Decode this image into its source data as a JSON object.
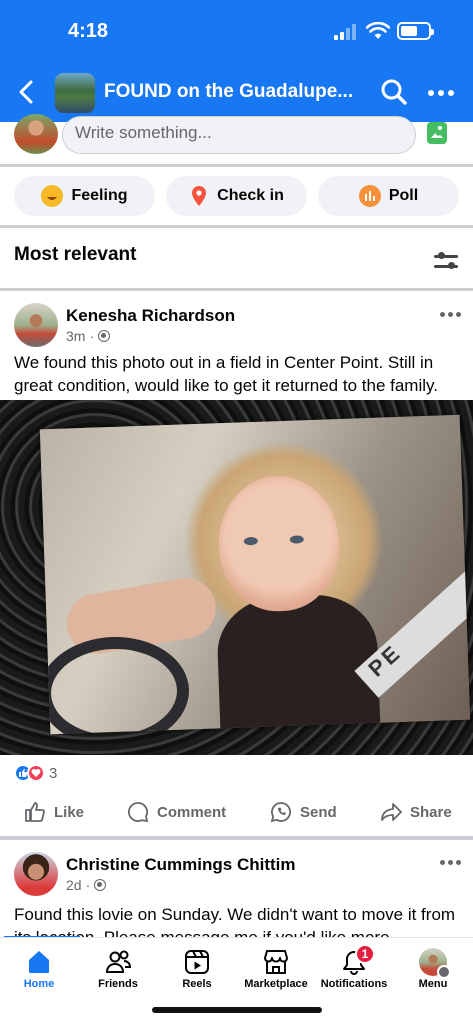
{
  "status_bar": {
    "time": "4:18"
  },
  "header": {
    "title": "FOUND on the Guadalupe...",
    "back_label": "Back"
  },
  "composer": {
    "placeholder": "Write something..."
  },
  "quick_actions": [
    {
      "label": "Feeling",
      "icon": "smiley-icon"
    },
    {
      "label": "Check in",
      "icon": "location-pin-icon"
    },
    {
      "label": "Poll",
      "icon": "poll-icon"
    }
  ],
  "feed": {
    "sort_label": "Most relevant"
  },
  "posts": [
    {
      "author": "Kenesha Richardson",
      "time": "3m",
      "text": "We found this photo out in a field in Center Point. Still in great condition, would like to get it returned to the family.",
      "reaction_count": "3",
      "image_text": "PE"
    },
    {
      "author": "Christine Cummings Chittim",
      "time": "2d",
      "text": "Found this lovie on Sunday. We didn't want to move it from its location. Please message me if you'd like more"
    }
  ],
  "post_actions": {
    "like": "Like",
    "comment": "Comment",
    "send": "Send",
    "share": "Share"
  },
  "tabs": [
    {
      "label": "Home",
      "icon": "home-icon"
    },
    {
      "label": "Friends",
      "icon": "friends-icon"
    },
    {
      "label": "Reels",
      "icon": "reels-icon"
    },
    {
      "label": "Marketplace",
      "icon": "marketplace-icon"
    },
    {
      "label": "Notifications",
      "icon": "bell-icon",
      "badge": "1"
    },
    {
      "label": "Menu",
      "icon": "menu-avatar-icon"
    }
  ],
  "colors": {
    "brand": "#1877f2",
    "badge": "#e41e3f",
    "like": "#1877f2",
    "love": "#f33e58"
  }
}
